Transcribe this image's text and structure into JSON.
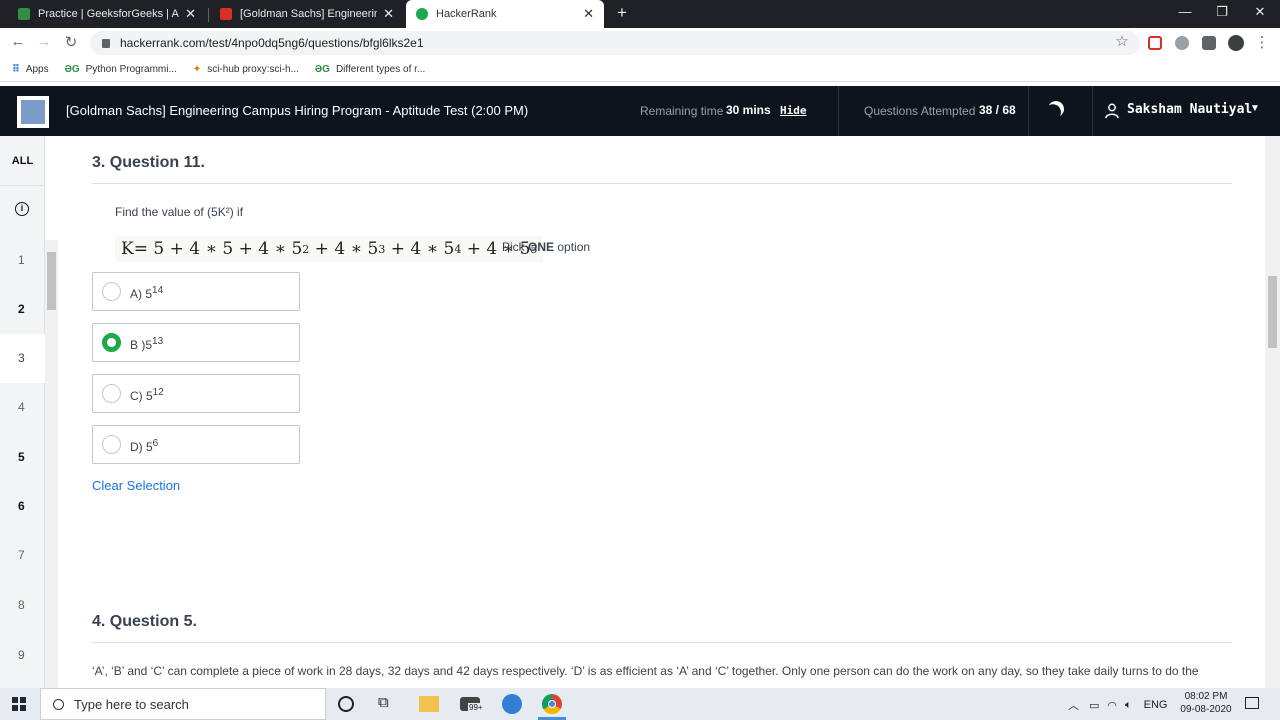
{
  "browser": {
    "tabs": [
      {
        "title": "Practice | GeeksforGeeks | A comp",
        "favicon_color": "#2f8d46",
        "active": false
      },
      {
        "title": "[Goldman Sachs] Engineering Ca",
        "favicon_color": "#d93025",
        "active": false
      },
      {
        "title": "HackerRank",
        "favicon_color": "#1ba94c",
        "active": true
      }
    ],
    "new_tab": "+",
    "url": "hackerrank.com/test/4npo0dq5ng6/questions/bfgl6lks2e1",
    "bookmarks": [
      {
        "icon": "apps-grid-icon",
        "label": "Apps"
      },
      {
        "icon": "geeksforgeeks-icon",
        "label": "Python Programmi..."
      },
      {
        "icon": "scihub-icon",
        "label": "sci-hub proxy:sci-h..."
      },
      {
        "icon": "geeksforgeeks-icon",
        "label": "Different types of r..."
      }
    ]
  },
  "header": {
    "test_title": "[Goldman Sachs] Engineering Campus Hiring Program - Aptitude Test (2:00 PM)",
    "remaining_label": "Remaining time",
    "remaining_value": "30 mins",
    "hide_label": "Hide",
    "attempted_label": "Questions Attempted",
    "attempted_value": "38 / 68",
    "user_name": "Saksham Nautiyal"
  },
  "nav": {
    "all_label": "ALL",
    "items": [
      "1",
      "2",
      "3",
      "4",
      "5",
      "6",
      "7",
      "8",
      "9"
    ]
  },
  "question": {
    "heading": "3. Question 11.",
    "prompt": "Find the value of (5K²) if",
    "formula_lhs": "K=",
    "pick_prefix": "Pick ",
    "pick_bold": "ONE",
    "pick_suffix": " option",
    "options": [
      {
        "label": "A) 5",
        "exp": "14",
        "selected": false
      },
      {
        "label": "B )5",
        "exp": "13",
        "selected": true
      },
      {
        "label": "C) 5",
        "exp": "12",
        "selected": false
      },
      {
        "label": "D) 5",
        "exp": "6",
        "selected": false
      }
    ],
    "clear_selection": "Clear Selection"
  },
  "next_question": {
    "heading": "4. Question 5.",
    "text": "‘A’, ‘B’ and ‘C’ can complete a piece of work in 28 days, 32 days and 42 days respectively. ‘D’ is as efficient as ‘A’ and ‘C’ together. Only one person can do the work on any day, so they take daily turns to do the"
  },
  "taskbar": {
    "search_placeholder": "Type here to search",
    "mail_badge": "99+",
    "lang": "ENG",
    "time": "08:02 PM",
    "date": "09-08-2020"
  }
}
